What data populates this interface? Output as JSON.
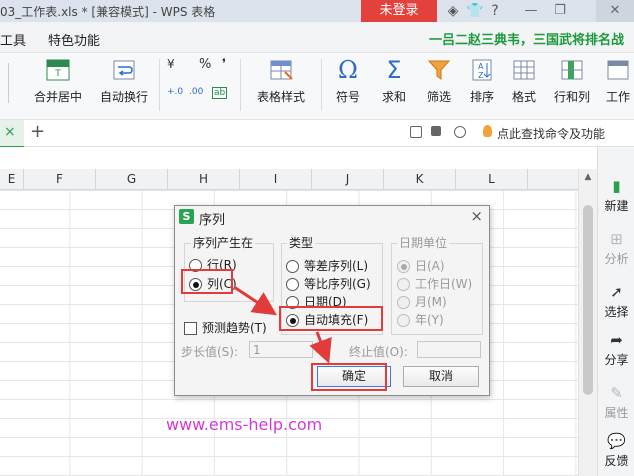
{
  "titlebar": {
    "title": "03_工作表.xls * [兼容模式] - WPS 表格",
    "login_label": "未登录",
    "icons": [
      "skin-icon",
      "shirt-icon",
      "help-icon",
      "minimize-icon",
      "restore-icon",
      "close-icon"
    ]
  },
  "menubar": {
    "items": [
      "工具",
      "特色功能"
    ],
    "promo": "一吕二赵三典韦，三国武将排名战"
  },
  "ribbon": {
    "buttons": [
      {
        "label": "合并居中",
        "icon": "merge-center-icon"
      },
      {
        "label": "自动换行",
        "icon": "wrap-text-icon"
      },
      {
        "label": "表格样式",
        "icon": "table-style-icon"
      },
      {
        "label": "符号",
        "icon": "omega-icon"
      },
      {
        "label": "求和",
        "icon": "sigma-icon"
      },
      {
        "label": "筛选",
        "icon": "filter-icon"
      },
      {
        "label": "排序",
        "icon": "sort-icon"
      },
      {
        "label": "格式",
        "icon": "format-icon"
      },
      {
        "label": "行和列",
        "icon": "rows-cols-icon"
      },
      {
        "label": "工作",
        "icon": "sheet-icon"
      }
    ],
    "number_symbols": [
      "¥",
      "%",
      "❜",
      "+.0",
      ".00",
      "ab"
    ]
  },
  "tabrow": {
    "close_glyph": "×",
    "add_glyph": "+",
    "find_command": "点此查找命令及功能"
  },
  "columns": [
    "E",
    "F",
    "G",
    "H",
    "I",
    "J",
    "K",
    "L"
  ],
  "sidepanel": {
    "items": [
      {
        "label": "新建",
        "icon": "new-icon",
        "enabled": true
      },
      {
        "label": "分析",
        "icon": "analysis-icon",
        "enabled": false
      },
      {
        "label": "选择",
        "icon": "select-icon",
        "enabled": true
      },
      {
        "label": "分享",
        "icon": "share-icon",
        "enabled": true
      },
      {
        "label": "属性",
        "icon": "properties-icon",
        "enabled": false
      },
      {
        "label": "反馈",
        "icon": "feedback-icon",
        "enabled": true
      }
    ]
  },
  "dialog": {
    "logo": "S",
    "title": "序列",
    "close_glyph": "×",
    "series_in": {
      "title": "序列产生在",
      "options": [
        {
          "label": "行(R)",
          "selected": false
        },
        {
          "label": "列(C)",
          "selected": true
        }
      ]
    },
    "type": {
      "title": "类型",
      "options": [
        {
          "label": "等差序列(L)",
          "selected": false
        },
        {
          "label": "等比序列(G)",
          "selected": false
        },
        {
          "label": "日期(D)",
          "selected": false
        },
        {
          "label": "自动填充(F)",
          "selected": true
        }
      ]
    },
    "date_unit": {
      "title": "日期单位",
      "options": [
        {
          "label": "日(A)",
          "selected": true
        },
        {
          "label": "工作日(W)",
          "selected": false
        },
        {
          "label": "月(M)",
          "selected": false
        },
        {
          "label": "年(Y)",
          "selected": false
        }
      ]
    },
    "trend_label": "预测趋势(T)",
    "trend_checked": false,
    "step_label": "步长值(S):",
    "step_value": "1",
    "stop_label": "终止值(O):",
    "stop_value": "",
    "ok_label": "确定",
    "cancel_label": "取消"
  },
  "annotations": {
    "color": "#e23b3b"
  },
  "watermark": "www.ems-help.com"
}
